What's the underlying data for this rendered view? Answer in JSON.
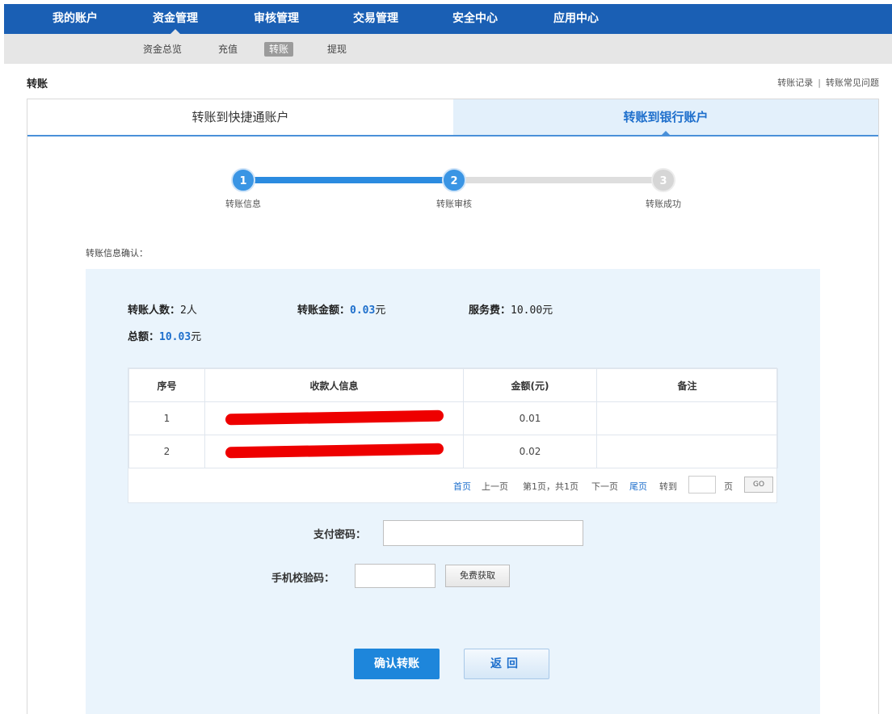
{
  "topnav": {
    "items": [
      "我的账户",
      "资金管理",
      "审核管理",
      "交易管理",
      "安全中心",
      "应用中心"
    ],
    "active_index": 1
  },
  "subnav": {
    "items": [
      "资金总览",
      "充值",
      "转账",
      "提现"
    ],
    "active_index": 2
  },
  "page": {
    "title": "转账",
    "links": [
      "转账记录",
      "转账常见问题"
    ],
    "link_separator": "|"
  },
  "tabs": [
    "转账到快捷通账户",
    "转账到银行账户"
  ],
  "active_tab": 1,
  "steps": {
    "items": [
      {
        "num": "1",
        "label": "转账信息"
      },
      {
        "num": "2",
        "label": "转账审核"
      },
      {
        "num": "3",
        "label": "转账成功"
      }
    ],
    "current": 2
  },
  "confirm_label": "转账信息确认：",
  "summary": {
    "count_label": "转账人数：",
    "count_value": "2人",
    "amount_label": "转账金额：",
    "amount_value": "0.03",
    "amount_unit": "元",
    "fee_label": "服务费：",
    "fee_value": "10.00元",
    "total_label": "总额：",
    "total_value": "10.03",
    "total_unit": "元"
  },
  "table": {
    "headers": [
      "序号",
      "收款人信息",
      "金额(元)",
      "备注"
    ],
    "rows": [
      {
        "no": "1",
        "payee": "[redacted]",
        "amount": "0.01",
        "note": ""
      },
      {
        "no": "2",
        "payee": "[redacted]",
        "amount": "0.02",
        "note": ""
      }
    ]
  },
  "pager": {
    "first": "首页",
    "prev": "上一页",
    "info": "第1页，共1页",
    "next": "下一页",
    "last": "尾页",
    "goto": "转到",
    "page_unit": "页",
    "go": "GO"
  },
  "form": {
    "pay_password_label": "支付密码：",
    "sms_code_label": "手机校验码：",
    "sms_button": "免费获取"
  },
  "buttons": {
    "confirm": "确认转账",
    "back": "返回"
  },
  "colors": {
    "nav_blue": "#1a5fb4",
    "accent_blue": "#1e86db",
    "confirm_bg": "#eaf4fc"
  }
}
